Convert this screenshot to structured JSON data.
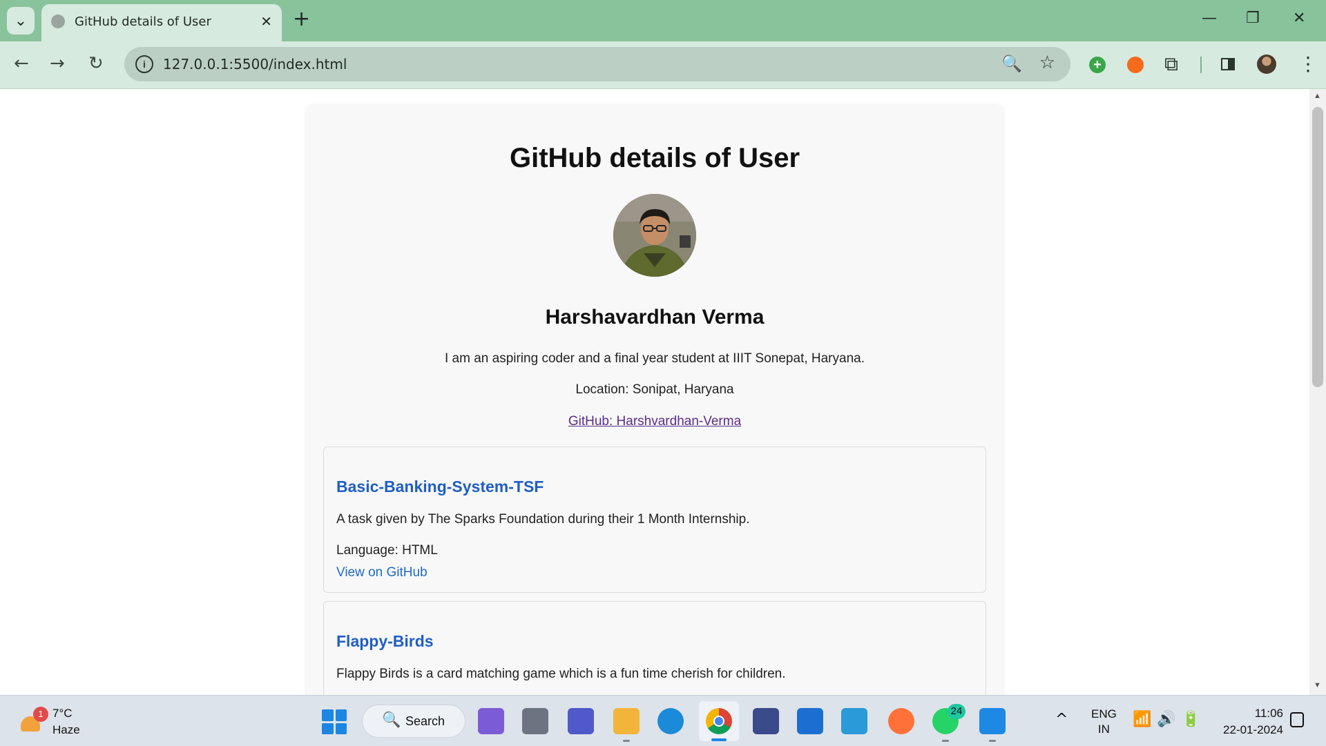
{
  "browser": {
    "tab_title": "GitHub details of User",
    "tab_close_glyph": "✕",
    "new_tab_glyph": "+",
    "url": "127.0.0.1:5500/index.html",
    "info_glyph": "i",
    "back_glyph": "←",
    "forward_glyph": "→",
    "reload_glyph": "↻",
    "zoom_glyph": "🔍",
    "star_glyph": "☆",
    "extension_plus_glyph": "+",
    "extension_puzzle_glyph": "⧉",
    "menu_glyph": "⋮",
    "minimize_glyph": "—",
    "restore_glyph": "❐",
    "close_glyph": "✕",
    "tab_search_glyph": "⌄"
  },
  "page": {
    "title": "GitHub details of User",
    "user": {
      "name": "Harshavardhan Verma",
      "bio": "I am an aspiring coder and a final year student at IIIT Sonepat, Haryana.",
      "location_label": "Location: Sonipat, Haryana",
      "github_link_text": "GitHub: Harshvardhan-Verma"
    },
    "repos": [
      {
        "name": "Basic-Banking-System-TSF",
        "description": "A task given by The Sparks Foundation during their 1 Month Internship.",
        "language": "Language: HTML",
        "link_text": "View on GitHub"
      },
      {
        "name": "Flappy-Birds",
        "description": "Flappy Birds is a card matching game which is a fun time cherish for children."
      }
    ]
  },
  "taskbar": {
    "weather_temp": "7°C",
    "weather_cond": "Haze",
    "weather_badge": "1",
    "search_label": "Search",
    "search_glyph": "🔍",
    "whatsapp_badge": "24",
    "tray_chevron": "^",
    "lang_line1": "ENG",
    "lang_line2": "IN",
    "tray_glyphs": "📶🔊🔋",
    "time": "11:06",
    "date": "22-01-2024",
    "apps": [
      {
        "name": "copilot",
        "color": "#7c5cd6"
      },
      {
        "name": "task-view",
        "color": "#6b7480"
      },
      {
        "name": "teams",
        "color": "#5059c9"
      },
      {
        "name": "file-explorer",
        "color": "#f2b53a"
      },
      {
        "name": "edge",
        "color": "#1b8ad8"
      },
      {
        "name": "chrome",
        "color": "#db4437"
      },
      {
        "name": "devhome",
        "color": "#3b4a8a"
      },
      {
        "name": "mail",
        "color": "#1c6fd1"
      },
      {
        "name": "remote-desktop",
        "color": "#2a9ad8"
      },
      {
        "name": "firefox",
        "color": "#ff7139"
      },
      {
        "name": "whatsapp",
        "color": "#25d366"
      },
      {
        "name": "vscode",
        "color": "#1e88e5"
      }
    ]
  }
}
